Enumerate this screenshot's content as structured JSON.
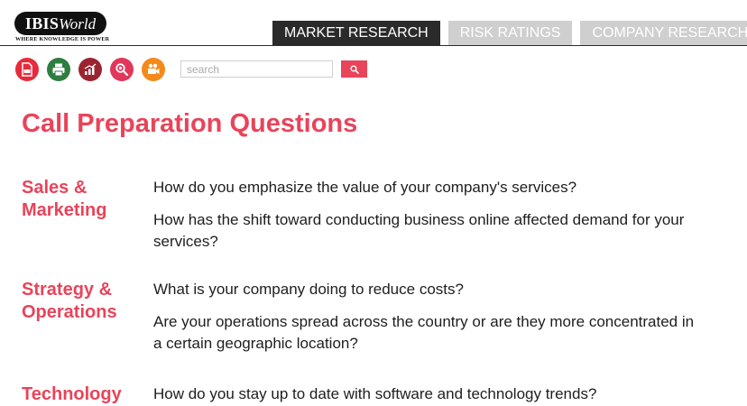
{
  "logo": {
    "ibis": "IBIS",
    "world": "World",
    "tagline": "WHERE KNOWLEDGE IS POWER"
  },
  "nav": {
    "tabs": [
      {
        "label": "MARKET RESEARCH",
        "active": true
      },
      {
        "label": "RISK RATINGS",
        "active": false
      },
      {
        "label": "COMPANY RESEARCH",
        "active": false
      }
    ]
  },
  "toolbar": {
    "icons": [
      "pdf-icon",
      "print-icon",
      "chart-icon",
      "search-zoom-icon",
      "video-camera-icon"
    ]
  },
  "search": {
    "placeholder": "search",
    "button_icon": "search-icon"
  },
  "page": {
    "title": "Call Preparation Questions"
  },
  "sections": [
    {
      "label": "Sales & Marketing",
      "questions": [
        "How do you emphasize the value of your company's services?",
        "How has the shift toward conducting business online affected demand for your services?"
      ]
    },
    {
      "label": "Strategy & Operations",
      "questions": [
        "What is your company doing to reduce costs?",
        "Are your operations spread across the country or are they more concentrated in a certain geographic location?"
      ]
    },
    {
      "label": "Technology",
      "questions": [
        "How do you stay up to date with software and technology trends?"
      ]
    }
  ],
  "colors": {
    "accent": "#e8445a",
    "nav_active": "#2b2b2b",
    "nav_inactive": "#cfcfcf"
  }
}
